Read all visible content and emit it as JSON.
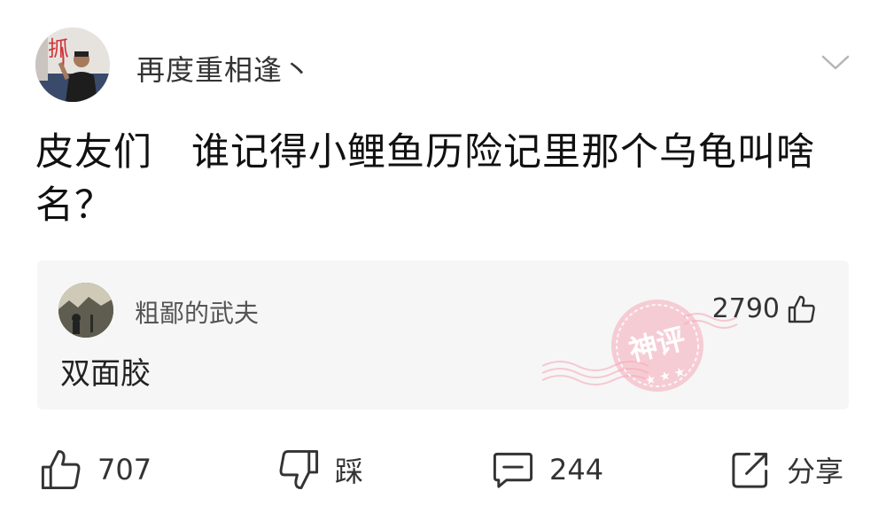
{
  "post": {
    "author": "再度重相逢丶",
    "text": "皮友们　谁记得小鲤鱼历险记里那个乌龟叫啥名？"
  },
  "god_comment": {
    "author": "粗鄙的武夫",
    "likes": "2790",
    "text": "双面胶",
    "stamp_label": "神评",
    "stamp_color": "#f08aa0"
  },
  "actions": {
    "like_count": "707",
    "dislike_label": "踩",
    "comment_count": "244",
    "share_label": "分享"
  },
  "icons": [
    "chevron-down-icon",
    "thumbs-up-icon",
    "thumbs-down-icon",
    "comment-icon",
    "share-icon"
  ]
}
